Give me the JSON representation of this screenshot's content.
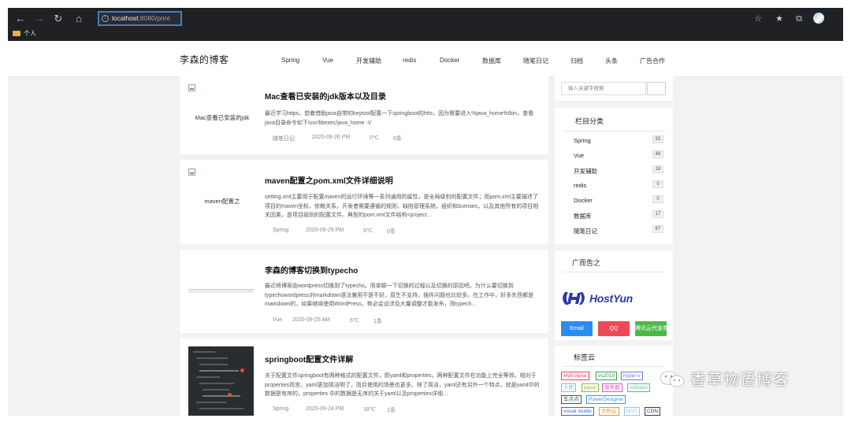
{
  "browser": {
    "url_host": "localhost",
    "url_rest": ":8080/print",
    "bookmark_folder": "个人"
  },
  "site": {
    "logo": "李森的博客",
    "nav": [
      "Spring",
      "Vue",
      "开发辅助",
      "redis",
      "Docker",
      "数据库",
      "随笔日记",
      "归档",
      "头条",
      "广告合作"
    ]
  },
  "posts": [
    {
      "thumb_alt": "Mac查看已安装的jdk",
      "title": "Mac查看已安装的jdk版本以及目录",
      "excerpt": "最近学习https，想着借助java自带的keytool配置一下springboot的htts，因为需要进入%java_home%/bin，查看java目录命令如下/usr/libexec/java_home -V",
      "category": "随笔日记",
      "date": "2020-09-26 PM",
      "temp": "0℃",
      "comments": "0条"
    },
    {
      "thumb_alt": "maven配置之",
      "title": "maven配置之pom.xml文件详细说明",
      "excerpt": "setting.xml主要用于配置maven的运行环境等一系列通用的属性，是全局级别的配置文件；而pom.xml主要描述了项目的maven坐标，依赖关系，开发者需要遵循的规则，缺陷管理系统，组织和licenses，以及其他所有的项目相关因素，是项目级别的配置文件。典型的pom.xml文件结构<project…",
      "category": "Spring",
      "date": "2020-09-25 PM",
      "temp": "9℃",
      "comments": "0条"
    },
    {
      "thumb_alt": "",
      "title": "李森的博客切换到typecho",
      "excerpt": "最近将博客由wordpress切换到了typecho。简单聊一下切换的过程以及切换的原因吧。为什么要切换到typechowordpress对markdown语法兼用不是不好，原生不支持，插件问题也比较多。在工作中，好多东西都是markdown的，如果继续使用WordPress，势必会设涉及大量调整才能发布，而typech…",
      "category": "Vue",
      "date": "2020-09-25 AM",
      "temp": "6℃",
      "comments": "1条"
    },
    {
      "thumb_alt": "",
      "title": "springboot配置文件详解",
      "excerpt": "关于配置文件springboot有两种格式的配置文件，即yaml和properties，两种配置文件在功能上完全等效。相对于 properties而言，yaml更加简洁明了，而且使用的场景也更多。除了简洁，yaml还有另外一个特点，就是yaml中的数据是有序的，properties 中的数据是无序的关于yaml以及properties详细…",
      "category": "Spring",
      "date": "2020-09-24 PM",
      "temp": "18℃",
      "comments": "1条"
    }
  ],
  "sidebar": {
    "search_placeholder": "输入关键字搜索",
    "categories_title": "栏目分类",
    "categories": [
      {
        "label": "Spring",
        "count": "93"
      },
      {
        "label": "Vue",
        "count": "48"
      },
      {
        "label": "开发辅助",
        "count": "18"
      },
      {
        "label": "redis",
        "count": "0"
      },
      {
        "label": "Docker",
        "count": "0"
      },
      {
        "label": "数据库",
        "count": "17"
      },
      {
        "label": "随笔日记",
        "count": "67"
      }
    ],
    "ad_title": "广而告之",
    "ad_brand": "HostYun",
    "ad_buttons": [
      {
        "label": "Email",
        "color": "#2d8cf0"
      },
      {
        "label": "QQ",
        "color": "#ed4a54"
      },
      {
        "label": "腾讯云代金券",
        "color": "#4cb848"
      }
    ],
    "tags_title": "标签云",
    "tags": [
      {
        "label": "MyEclipse",
        "color": "#e8435a"
      },
      {
        "label": "vs2019",
        "color": "#3a9a57"
      },
      {
        "label": "hyper-v",
        "color": "#6c7bd6"
      },
      {
        "label": "大图",
        "color": "#72c5ea"
      },
      {
        "label": "pgsql",
        "color": "#7fbf3a"
      },
      {
        "label": "服务器",
        "color": "#e855c8"
      },
      {
        "label": "nofocus",
        "color": "#4bc18a"
      },
      {
        "label": "车点点",
        "color": "#4a5160"
      },
      {
        "label": "PowerDesigner",
        "color": "#3497de"
      },
      {
        "label": "visual studio",
        "color": "#3d63c4"
      },
      {
        "label": "文档云",
        "color": "#f0932b"
      },
      {
        "label": "MVC",
        "color": "#8ec7ef"
      },
      {
        "label": "CDN",
        "color": "#2e3a54"
      }
    ]
  },
  "watermark": "香草物语博客"
}
